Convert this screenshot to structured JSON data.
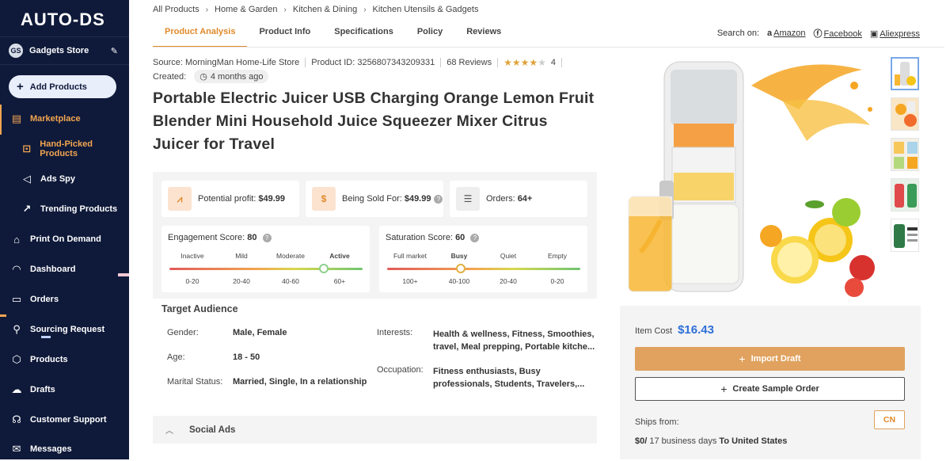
{
  "sidebar": {
    "logo": "AUTO-DS",
    "store_initials": "GS",
    "store_name": "Gadgets Store",
    "add_products": "Add Products",
    "items": [
      {
        "label": "Marketplace",
        "icon": "store-icon"
      },
      {
        "label": "Hand-Picked Products",
        "icon": "star-box-icon"
      },
      {
        "label": "Ads Spy",
        "icon": "megaphone-icon"
      },
      {
        "label": "Trending Products",
        "icon": "trend-chart-icon"
      },
      {
        "label": "Print On Demand",
        "icon": "shop-icon"
      },
      {
        "label": "Dashboard",
        "icon": "gauge-icon"
      },
      {
        "label": "Orders",
        "icon": "truck-icon"
      },
      {
        "label": "Sourcing Request",
        "icon": "search-person-icon"
      },
      {
        "label": "Products",
        "icon": "box-icon"
      },
      {
        "label": "Drafts",
        "icon": "cloud-upload-icon"
      },
      {
        "label": "Customer Support",
        "icon": "headset-icon"
      },
      {
        "label": "Messages",
        "icon": "envelope-icon"
      }
    ]
  },
  "breadcrumbs": [
    "All Products",
    "Home & Garden",
    "Kitchen & Dining",
    "Kitchen Utensils & Gadgets"
  ],
  "tabs": [
    "Product Analysis",
    "Product Info",
    "Specifications",
    "Policy",
    "Reviews"
  ],
  "search_on": {
    "label": "Search on:",
    "links": [
      "Amazon",
      "Facebook",
      "Aliexpress"
    ]
  },
  "meta": {
    "source": "Source: MorningMan Home-Life Store",
    "product_id": "Product ID: 3256807343209331",
    "reviews": "68 Reviews",
    "rating": "4",
    "created_label": "Created:",
    "created_value": "4 months ago"
  },
  "title": "Portable Electric Juicer USB Charging Orange Lemon Fruit Blender Mini Household Juice Squeezer Mixer Citrus Juicer for Travel",
  "stats": {
    "profit_label": "Potential profit:",
    "profit_value": "$49.99",
    "sold_label": "Being Sold For:",
    "sold_value": "$49.99",
    "orders_label": "Orders:",
    "orders_value": "64+"
  },
  "engagement": {
    "label": "Engagement Score:",
    "value": "80",
    "scale": [
      "Inactive",
      "Mild",
      "Moderate",
      "Active"
    ],
    "ranges": [
      "0-20",
      "20-40",
      "40-60",
      "60+"
    ],
    "level": 0.8
  },
  "saturation": {
    "label": "Saturation Score:",
    "value": "60",
    "scale": [
      "Full market",
      "Busy",
      "Quiet",
      "Empty"
    ],
    "ranges": [
      "100+",
      "40-100",
      "20-40",
      "0-20"
    ],
    "level": 0.38
  },
  "audience": {
    "title": "Target Audience",
    "gender_label": "Gender:",
    "gender": "Male, Female",
    "age_label": "Age:",
    "age": "18 - 50",
    "marital_label": "Marital Status:",
    "marital": "Married, Single, In a relationship",
    "interests_label": "Interests:",
    "interests_1": "Health & wellness, Fitness, Smoothies,",
    "interests_2": "travel, Meal prepping, Portable kitche...",
    "occupation_label": "Occupation:",
    "occupation_1": "Fitness enthusiasts, Busy",
    "occupation_2": "professionals, Students, Travelers,..."
  },
  "social_ads": "Social Ads",
  "buybox": {
    "item_cost_label": "Item Cost",
    "item_cost": "$16.43",
    "import_draft": "Import Draft",
    "create_sample": "Create Sample Order",
    "ships_from": "Ships from:",
    "country": "CN",
    "shipping_price": "$0/",
    "shipping_days": " 17 business days ",
    "shipping_to": "To United States"
  },
  "colors": {
    "sidebar_bg": "#0f1a3a",
    "accent": "#e08a2a",
    "price_blue": "#2e6fd8"
  }
}
